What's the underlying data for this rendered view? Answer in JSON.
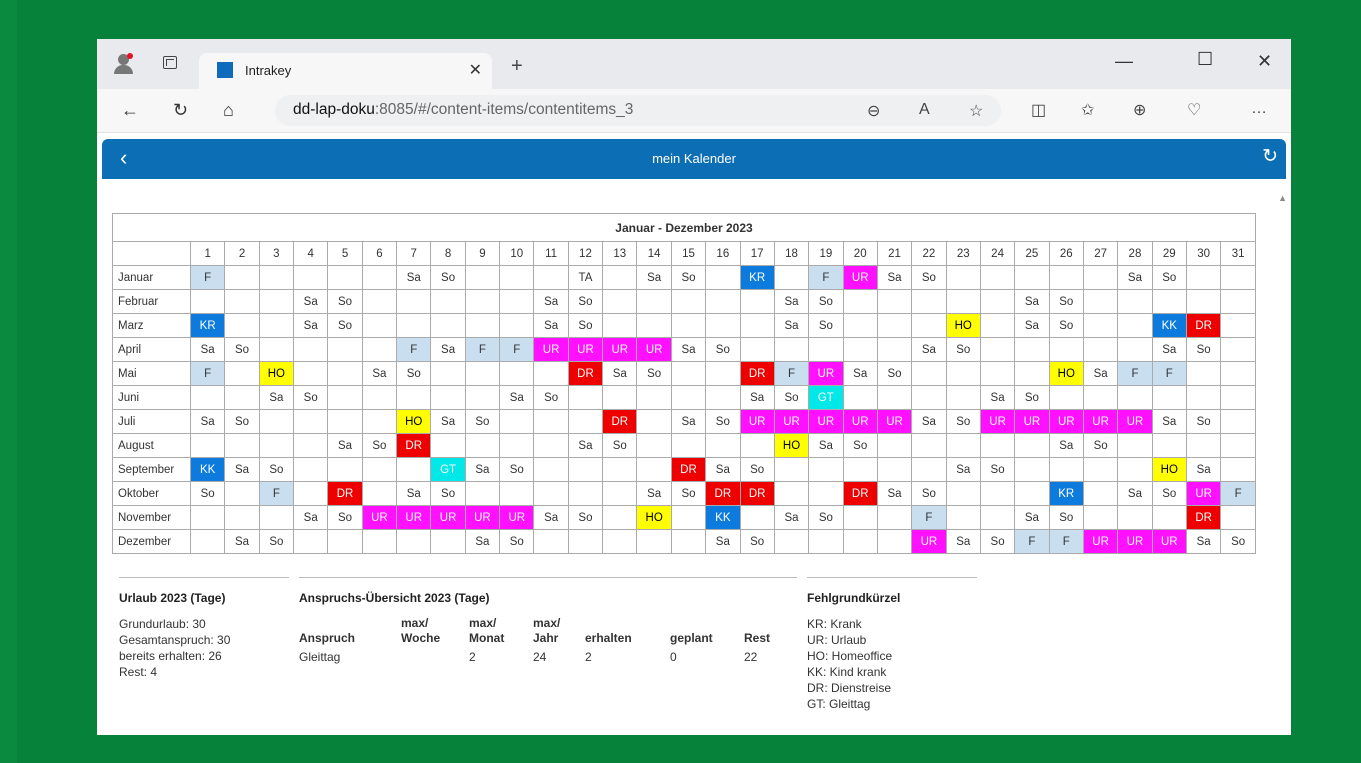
{
  "browser": {
    "tab_title": "Intrakey",
    "url_host": "dd-lap-doku",
    "url_rest": ":8085/#/content-items/contentitems_3"
  },
  "app": {
    "title": "mein Kalender"
  },
  "calendar": {
    "title": "Januar - Dezember 2023",
    "days": [
      "1",
      "2",
      "3",
      "4",
      "5",
      "6",
      "7",
      "8",
      "9",
      "10",
      "11",
      "12",
      "13",
      "14",
      "15",
      "16",
      "17",
      "18",
      "19",
      "20",
      "21",
      "22",
      "23",
      "24",
      "25",
      "26",
      "27",
      "28",
      "29",
      "30",
      "31"
    ],
    "months": [
      {
        "name": "Januar",
        "cells": [
          "F",
          "",
          "",
          "",
          "",
          "",
          "Sa",
          "So",
          "",
          "",
          "",
          "TA",
          "",
          "Sa",
          "So",
          "",
          "KR",
          "",
          "F",
          "UR",
          "Sa",
          "So",
          "",
          "",
          "",
          "",
          "",
          "Sa",
          "So",
          "",
          ""
        ]
      },
      {
        "name": "Februar",
        "cells": [
          "",
          "",
          "",
          "Sa",
          "So",
          "",
          "",
          "",
          "",
          "",
          "Sa",
          "So",
          "",
          "",
          "",
          "",
          "",
          "Sa",
          "So",
          "",
          "",
          "",
          "",
          "",
          "Sa",
          "So",
          "",
          "",
          "",
          "",
          ""
        ]
      },
      {
        "name": "Marz",
        "cells": [
          "KR",
          "",
          "",
          "Sa",
          "So",
          "",
          "",
          "",
          "",
          "",
          "Sa",
          "So",
          "",
          "",
          "",
          "",
          "",
          "Sa",
          "So",
          "",
          "",
          "",
          "HO",
          "",
          "Sa",
          "So",
          "",
          "",
          "KK",
          "DR",
          ""
        ]
      },
      {
        "name": "April",
        "cells": [
          "Sa",
          "So",
          "",
          "",
          "",
          "",
          "F",
          "Sa",
          "F",
          "F",
          "UR",
          "UR",
          "UR",
          "UR",
          "Sa",
          "So",
          "",
          "",
          "",
          "",
          "",
          "Sa",
          "So",
          "",
          "",
          "",
          "",
          "",
          "Sa",
          "So",
          ""
        ]
      },
      {
        "name": "Mai",
        "cells": [
          "F",
          "",
          "HO",
          "",
          "",
          "Sa",
          "So",
          "",
          "",
          "",
          "",
          "DR",
          "Sa",
          "So",
          "",
          "",
          "DR",
          "F",
          "UR",
          "Sa",
          "So",
          "",
          "",
          "",
          "",
          "HO",
          "Sa",
          "F",
          "F",
          "",
          ""
        ]
      },
      {
        "name": "Juni",
        "cells": [
          "",
          "",
          "Sa",
          "So",
          "",
          "",
          "",
          "",
          "",
          "Sa",
          "So",
          "",
          "",
          "",
          "",
          "",
          "Sa",
          "So",
          "GT",
          "",
          "",
          "",
          "",
          "Sa",
          "So",
          "",
          "",
          "",
          "",
          "",
          ""
        ]
      },
      {
        "name": "Juli",
        "cells": [
          "Sa",
          "So",
          "",
          "",
          "",
          "",
          "HO",
          "Sa",
          "So",
          "",
          "",
          "",
          "DR",
          "",
          "Sa",
          "So",
          "UR",
          "UR",
          "UR",
          "UR",
          "UR",
          "Sa",
          "So",
          "UR",
          "UR",
          "UR",
          "UR",
          "UR",
          "Sa",
          "So",
          ""
        ]
      },
      {
        "name": "August",
        "cells": [
          "",
          "",
          "",
          "",
          "Sa",
          "So",
          "DR",
          "",
          "",
          "",
          "",
          "Sa",
          "So",
          "",
          "",
          "",
          "",
          "HO",
          "Sa",
          "So",
          "",
          "",
          "",
          "",
          "",
          "Sa",
          "So",
          "",
          "",
          "",
          ""
        ]
      },
      {
        "name": "September",
        "cells": [
          "KK",
          "Sa",
          "So",
          "",
          "",
          "",
          "",
          "GT",
          "Sa",
          "So",
          "",
          "",
          "",
          "",
          "DR",
          "Sa",
          "So",
          "",
          "",
          "",
          "",
          "",
          "Sa",
          "So",
          "",
          "",
          "",
          "",
          "HO",
          "Sa",
          ""
        ]
      },
      {
        "name": "Oktober",
        "cells": [
          "So",
          "",
          "F",
          "",
          "DR",
          "",
          "Sa",
          "So",
          "",
          "",
          "",
          "",
          "",
          "Sa",
          "So",
          "DR",
          "DR",
          "",
          "",
          "DR",
          "Sa",
          "So",
          "",
          "",
          "",
          "KR",
          "",
          "Sa",
          "So",
          "UR",
          "F"
        ]
      },
      {
        "name": "November",
        "cells": [
          "",
          "",
          "",
          "Sa",
          "So",
          "UR",
          "UR",
          "UR",
          "UR",
          "UR",
          "Sa",
          "So",
          "",
          "HO",
          "",
          "KK",
          "",
          "Sa",
          "So",
          "",
          "",
          "F",
          "",
          "",
          "Sa",
          "So",
          "",
          "",
          "",
          "DR",
          ""
        ]
      },
      {
        "name": "Dezember",
        "cells": [
          "",
          "Sa",
          "So",
          "",
          "",
          "",
          "",
          "",
          "Sa",
          "So",
          "",
          "",
          "",
          "",
          "",
          "Sa",
          "So",
          "",
          "",
          "",
          "",
          "UR",
          "Sa",
          "So",
          "F",
          "F",
          "UR",
          "UR",
          "UR",
          "Sa",
          "So"
        ]
      }
    ]
  },
  "urlaub": {
    "title": "Urlaub 2023 (Tage)",
    "lines": [
      "Grundurlaub: 30",
      "Gesamtanspruch: 30",
      "bereits erhalten: 26",
      "Rest: 4"
    ]
  },
  "anspruch": {
    "title": "Anspruchs-Übersicht 2023 (Tage)",
    "headers": [
      "Anspruch",
      "max/ Woche",
      "max/ Monat",
      "max/ Jahr",
      "erhalten",
      "geplant",
      "Rest"
    ],
    "row": [
      "Gleittag",
      "",
      "2",
      "24",
      "2",
      "0",
      "22"
    ]
  },
  "fehlgrund": {
    "title": "Fehlgrundkürzel",
    "lines": [
      "KR: Krank",
      "UR: Urlaub",
      "HO: Homeoffice",
      "KK: Kind krank",
      "DR: Dienstreise",
      "GT: Gleittag"
    ]
  },
  "colors": {
    "frame": "#07823a",
    "header_blue": "#0c6fb5",
    "KR": "#0d7bde",
    "UR": "#ff10ff",
    "HO": "#ffff00",
    "DR": "#ee0000",
    "GT": "#00e8e8",
    "F": "#c9dff0"
  }
}
